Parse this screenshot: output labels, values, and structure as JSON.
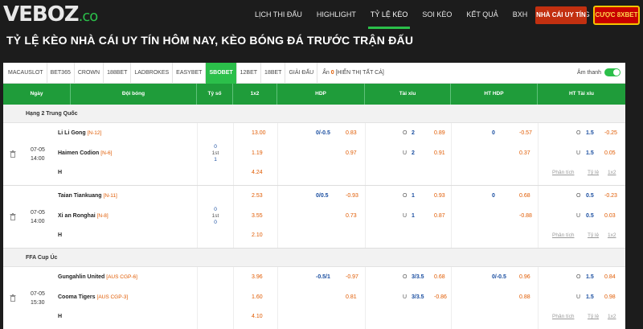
{
  "logo": {
    "main": "VEBOZ",
    "suffix": ".co"
  },
  "nav": [
    "LỊCH THI ĐẤU",
    "HIGHLIGHT",
    "TỶ LỆ KÈO",
    "SOI KÈO",
    "KẾT QUẢ",
    "BXH",
    "TUYỂN DỤNG"
  ],
  "nav_active": "TỶ LỆ KÈO",
  "btn_nhacai": "NHÀ CÁI UY TÍN",
  "btn_8xbet": "CƯỢC 8XBET",
  "page_title": "TỶ LỆ KÈO NHÀ CÁI UY TÍN HÔM NAY, KÈO BÓNG ĐÁ TRƯỚC TRẬN ĐẤU",
  "bookmakers": [
    "MACAUSLOT",
    "BET365",
    "CROWN",
    "188BET",
    "LADBROKES",
    "EASYBET",
    "SBOBET",
    "12BET",
    "18BET",
    "GIẢI ĐẤU"
  ],
  "bookmaker_active": "SBOBET",
  "hide": {
    "label": "Ẩn",
    "count": "0",
    "show_all": "[HIỂN THỊ TẤT CẢ]"
  },
  "sound_label": "Âm thanh",
  "headers": {
    "date": "Ngày",
    "team": "Đội bóng",
    "rate": "Tỷ số",
    "x12": "1x2",
    "hdp": "HDP",
    "tx": "Tài xỉu",
    "hthdp": "HT HDP",
    "httx": "HT Tài xỉu"
  },
  "links": {
    "analysis": "Phân tích",
    "rate": "Tỷ lệ",
    "x12": "1x2"
  },
  "colors": {
    "green": "#2bbf4a",
    "header_green": "#1f9c3a",
    "orange": "#e05a00",
    "blue": "#1a4ea0"
  },
  "leagues": [
    {
      "name": "Hạng 2 Trung Quốc"
    },
    {
      "name": "FFA Cup Úc"
    }
  ],
  "matches": [
    {
      "date": "07-05",
      "time": "14:00",
      "home": "Li Li Gong",
      "home_rank": "[N-12]",
      "away": "Haimen Codion",
      "away_rank": "[N-6]",
      "draw": "H",
      "score": [
        "0",
        "1st",
        "1"
      ],
      "x12": [
        "13.00",
        "1.19",
        "4.24"
      ],
      "hdp_line": "0/-0.5",
      "hdp": [
        "0.83",
        "0.97"
      ],
      "tx_o_label": "O",
      "tx_line": "2",
      "tx_u_label": "U",
      "tx_line2": "2",
      "tx": [
        "0.89",
        "0.91"
      ],
      "hthdp_line": "0",
      "hthdp": [
        "-0.57",
        "0.37"
      ],
      "httx_o_label": "O",
      "httx_line": "1.5",
      "httx_u_label": "U",
      "httx_line2": "1.5",
      "httx": [
        "-0.25",
        "0.05"
      ]
    },
    {
      "date": "07-05",
      "time": "14:00",
      "home": "Taian Tiankuang",
      "home_rank": "[N-11]",
      "away": "Xi an Ronghai",
      "away_rank": "[N-8]",
      "draw": "H",
      "score": [
        "0",
        "1st",
        "0"
      ],
      "x12": [
        "2.53",
        "3.55",
        "2.10"
      ],
      "hdp_line": "0/0.5",
      "hdp": [
        "-0.93",
        "0.73"
      ],
      "tx_o_label": "O",
      "tx_line": "1",
      "tx_u_label": "U",
      "tx_line2": "1",
      "tx": [
        "0.93",
        "0.87"
      ],
      "hthdp_line": "0",
      "hthdp": [
        "0.68",
        "-0.88"
      ],
      "httx_o_label": "O",
      "httx_line": "0.5",
      "httx_u_label": "U",
      "httx_line2": "0.5",
      "httx": [
        "-0.23",
        "0.03"
      ]
    },
    {
      "date": "07-05",
      "time": "15:30",
      "home": "Gungahlin United",
      "home_rank": "[AUS CGP-6]",
      "away": "Cooma Tigers",
      "away_rank": "[AUS CGP-3]",
      "draw": "H",
      "score": [
        "",
        "",
        ""
      ],
      "x12": [
        "3.96",
        "1.60",
        "4.10"
      ],
      "hdp_line": "-0.5/1",
      "hdp": [
        "-0.97",
        "0.81"
      ],
      "tx_o_label": "O",
      "tx_line": "3/3.5",
      "tx_u_label": "U",
      "tx_line2": "3/3.5",
      "tx": [
        "0.68",
        "-0.86"
      ],
      "hthdp_line": "0/-0.5",
      "hthdp": [
        "0.96",
        "0.88"
      ],
      "httx_o_label": "O",
      "httx_line": "1.5",
      "httx_u_label": "U",
      "httx_line2": "1.5",
      "httx": [
        "0.84",
        "0.98"
      ]
    }
  ]
}
